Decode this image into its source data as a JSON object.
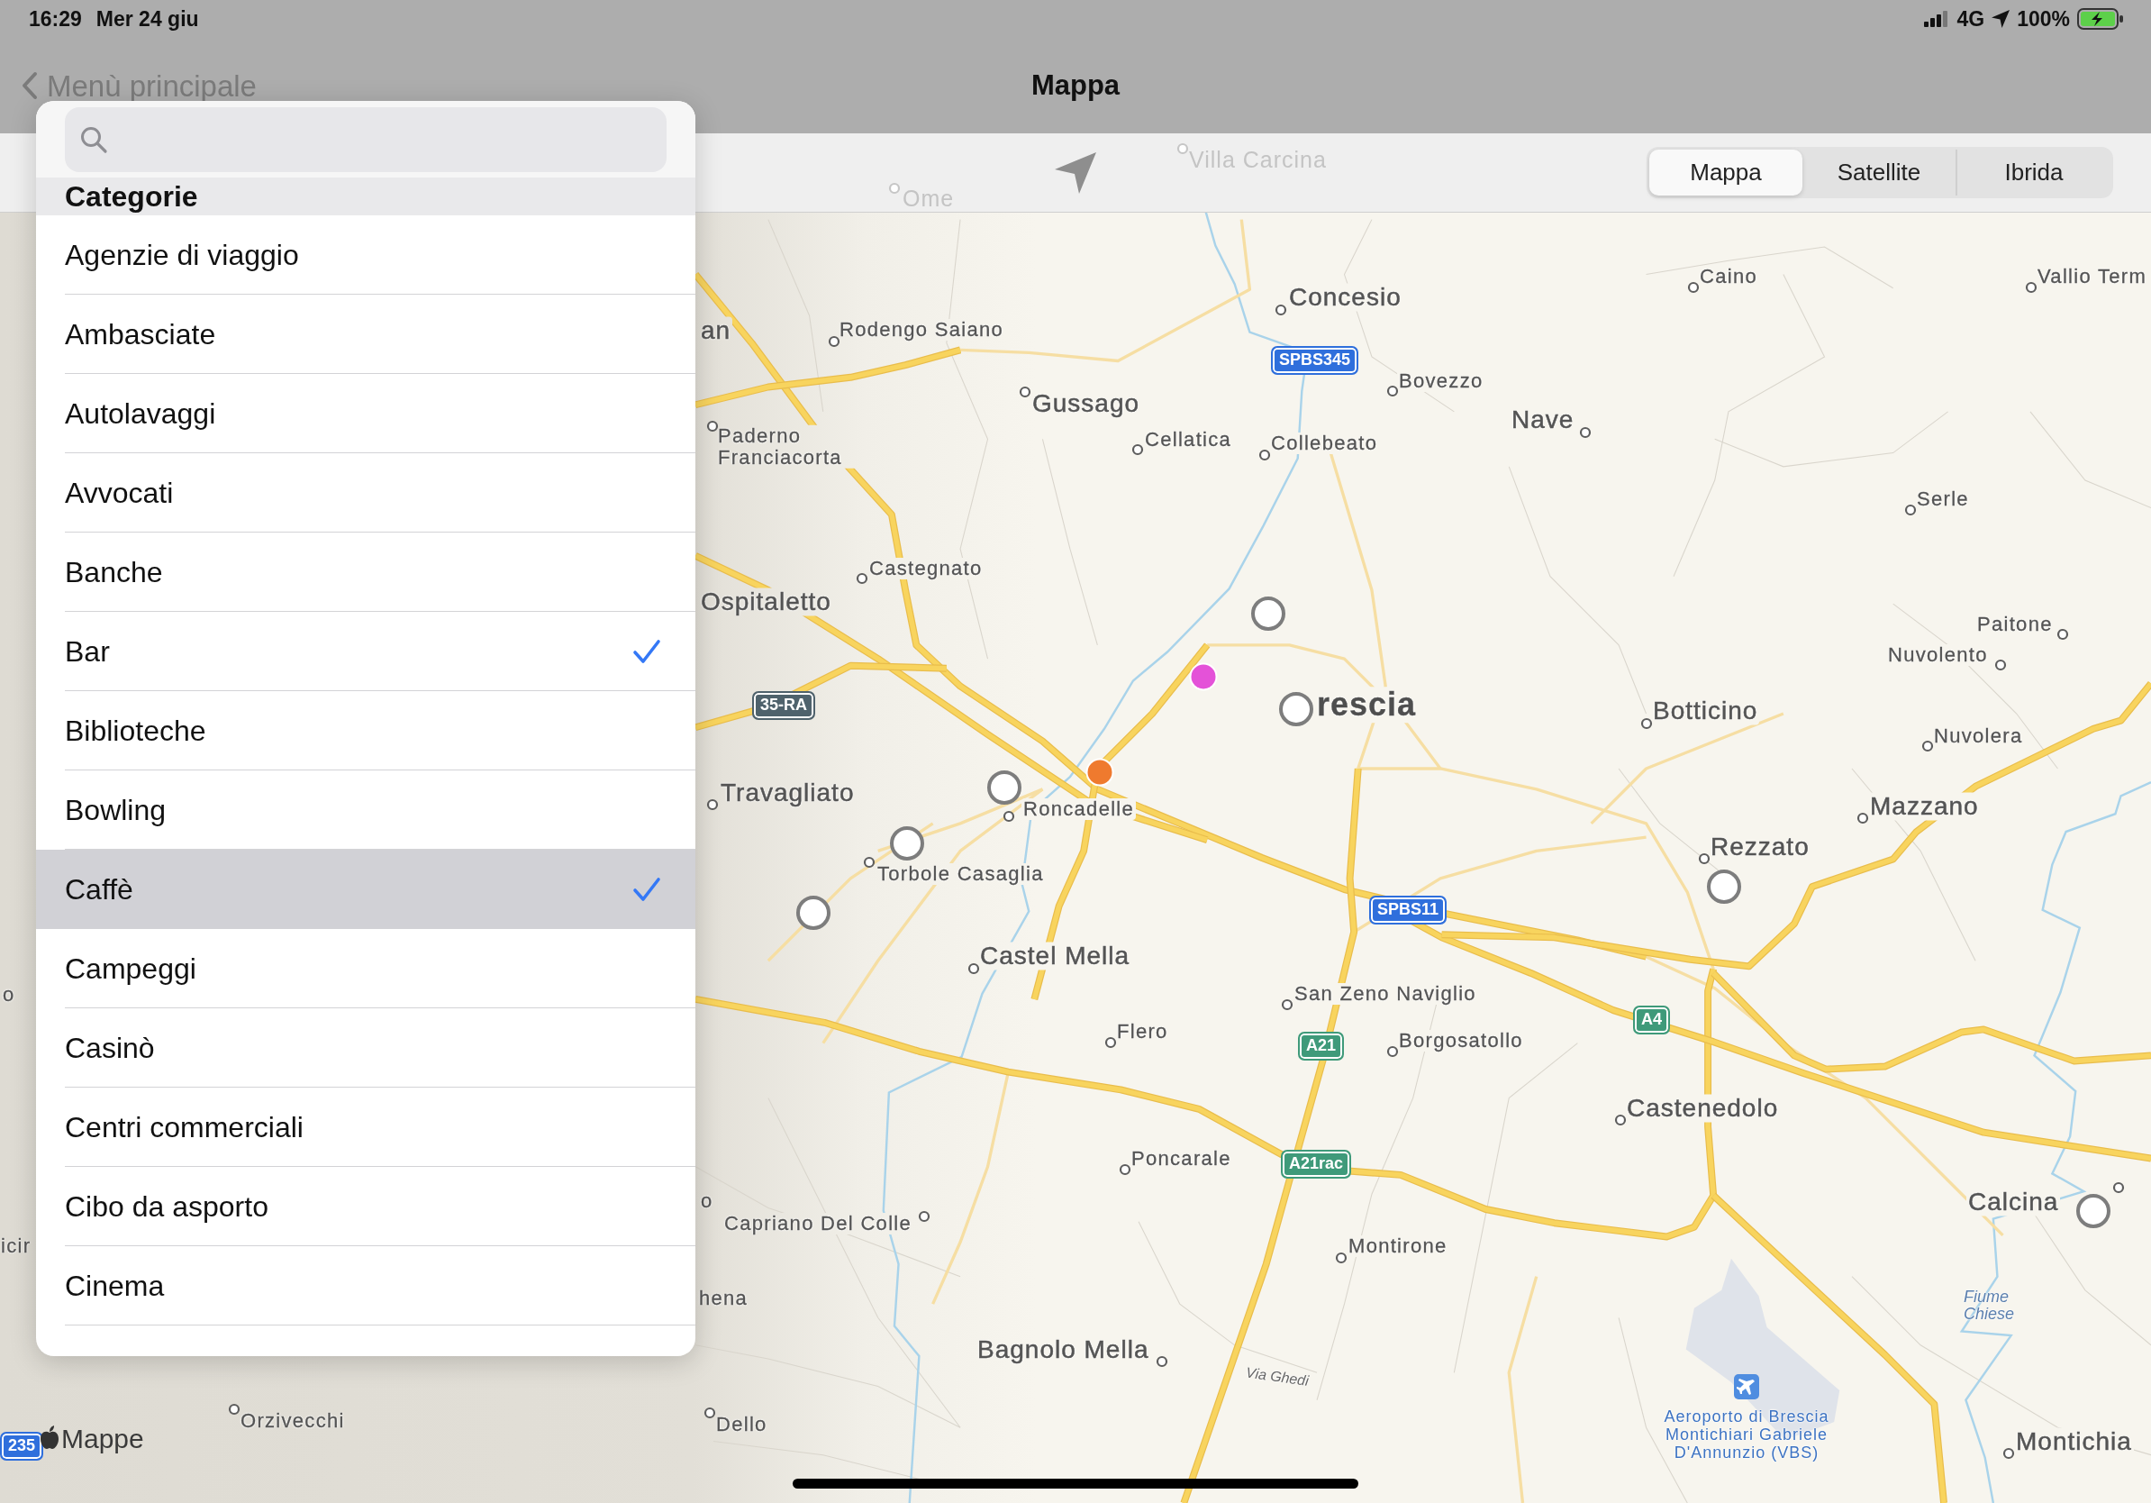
{
  "status_bar": {
    "time": "16:29",
    "date": "Mer 24 giu",
    "network": "4G",
    "battery": "100%"
  },
  "nav_bar": {
    "back_button": "Menù principale",
    "title": "Mappa"
  },
  "popover": {
    "section_title": "Categorie",
    "items": [
      {
        "label": "Agenzie di viaggio",
        "checked": false,
        "selected": false
      },
      {
        "label": "Ambasciate",
        "checked": false,
        "selected": false
      },
      {
        "label": "Autolavaggi",
        "checked": false,
        "selected": false
      },
      {
        "label": "Avvocati",
        "checked": false,
        "selected": false
      },
      {
        "label": "Banche",
        "checked": false,
        "selected": false
      },
      {
        "label": "Bar",
        "checked": true,
        "selected": false
      },
      {
        "label": "Biblioteche",
        "checked": false,
        "selected": false
      },
      {
        "label": "Bowling",
        "checked": false,
        "selected": false
      },
      {
        "label": "Caffè",
        "checked": true,
        "selected": true
      },
      {
        "label": "Campeggi",
        "checked": false,
        "selected": false
      },
      {
        "label": "Casinò",
        "checked": false,
        "selected": false
      },
      {
        "label": "Centri commerciali",
        "checked": false,
        "selected": false
      },
      {
        "label": "Cibo da asporto",
        "checked": false,
        "selected": false
      },
      {
        "label": "Cinema",
        "checked": false,
        "selected": false
      }
    ]
  },
  "toolbar": {
    "map_types": [
      {
        "label": "Mappa",
        "selected": true
      },
      {
        "label": "Satellite",
        "selected": false
      },
      {
        "label": "Ibrida",
        "selected": false
      }
    ]
  },
  "map": {
    "places": [
      {
        "name": "Villa Carcina",
        "kind": "faded"
      },
      {
        "name": "Ome",
        "kind": "faded"
      },
      {
        "name": "Caino",
        "kind": "town"
      },
      {
        "name": "Vallio Term",
        "kind": "town"
      },
      {
        "name": "Concesio",
        "kind": "large"
      },
      {
        "name": "an",
        "kind": "large"
      },
      {
        "name": "Rodengo Saiano",
        "kind": "town"
      },
      {
        "name": "Bovezzo",
        "kind": "town"
      },
      {
        "name": "Gussago",
        "kind": "large"
      },
      {
        "name": "Nave",
        "kind": "large"
      },
      {
        "name": "Paderno Franciacorta",
        "kind": "town"
      },
      {
        "name": "Cellatica",
        "kind": "town"
      },
      {
        "name": "Collebeato",
        "kind": "town"
      },
      {
        "name": "Serle",
        "kind": "town"
      },
      {
        "name": "Castegnato",
        "kind": "town"
      },
      {
        "name": "Ospitaletto",
        "kind": "large"
      },
      {
        "name": "Paitone",
        "kind": "town"
      },
      {
        "name": "Nuvolento",
        "kind": "town"
      },
      {
        "name": "rescia",
        "kind": "city"
      },
      {
        "name": "Botticino",
        "kind": "large"
      },
      {
        "name": "Nuvolera",
        "kind": "town"
      },
      {
        "name": "Travagliato",
        "kind": "large"
      },
      {
        "name": "Roncadelle",
        "kind": "town"
      },
      {
        "name": "Mazzano",
        "kind": "large"
      },
      {
        "name": "Rezzato",
        "kind": "large"
      },
      {
        "name": "Torbole Casaglia",
        "kind": "town"
      },
      {
        "name": "Castel Mella",
        "kind": "large"
      },
      {
        "name": "o",
        "kind": "town"
      },
      {
        "name": "San Zeno Naviglio",
        "kind": "town"
      },
      {
        "name": "Flero",
        "kind": "town"
      },
      {
        "name": "Borgosatollo",
        "kind": "town"
      },
      {
        "name": "Castenedolo",
        "kind": "large"
      },
      {
        "name": "Poncarale",
        "kind": "town"
      },
      {
        "name": "o",
        "kind": "town"
      },
      {
        "name": "Calcina",
        "kind": "large"
      },
      {
        "name": "Capriano Del Colle",
        "kind": "town"
      },
      {
        "name": "icir",
        "kind": "town"
      },
      {
        "name": "Montirone",
        "kind": "town"
      },
      {
        "name": "hena",
        "kind": "town"
      },
      {
        "name": "Fiume Chiese",
        "kind": "water"
      },
      {
        "name": "Bagnolo Mella",
        "kind": "large"
      },
      {
        "name": "Via Ghedi",
        "kind": "street"
      },
      {
        "name": "Orzivecchi",
        "kind": "town"
      },
      {
        "name": "Dello",
        "kind": "town"
      },
      {
        "name": "Aeroporto di Brescia Montichiari Gabriele D'Annunzio (VBS)",
        "kind": "airport"
      },
      {
        "name": "Montichia",
        "kind": "large"
      }
    ],
    "shields": [
      {
        "label": "SPBS345",
        "color": "#2f6fdc"
      },
      {
        "label": "35-RA",
        "color": "#4f626c"
      },
      {
        "label": "SPBS11",
        "color": "#2f6fdc"
      },
      {
        "label": "A4",
        "color": "#3f9a7a"
      },
      {
        "label": "A21",
        "color": "#3f9a7a"
      },
      {
        "label": "A21rac",
        "color": "#3f9a7a"
      },
      {
        "label": "235",
        "color": "#2f6fdc"
      }
    ],
    "pins": [
      {
        "kind": "place",
        "color": "#ffffff"
      },
      {
        "kind": "category",
        "color": "#e452d8"
      },
      {
        "kind": "place",
        "color": "#ffffff"
      },
      {
        "kind": "category",
        "color": "#ef7a2e"
      },
      {
        "kind": "place",
        "color": "#ffffff"
      },
      {
        "kind": "place",
        "color": "#ffffff"
      },
      {
        "kind": "place",
        "color": "#ffffff"
      },
      {
        "kind": "place",
        "color": "#ffffff"
      },
      {
        "kind": "place",
        "color": "#ffffff"
      }
    ],
    "attribution": "Mappe"
  }
}
